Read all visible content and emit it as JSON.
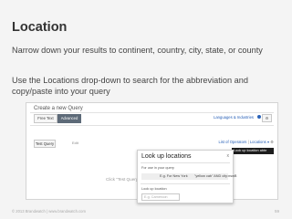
{
  "slide": {
    "title": "Location",
    "subtitle": "Narrow down your results to continent, country, city, state, or county",
    "note": "Use the Locations drop-down to search for the abbreviation and copy/paste into your query"
  },
  "app": {
    "heading": "Create a new Query",
    "tabs": [
      "Free Text",
      "Advanced"
    ],
    "active_tab": "Advanced",
    "languages_link": "Languages & Industries",
    "test_query_button": "Test Query",
    "edit_label": "Edit",
    "operators_link": "List of Operators",
    "locations_dropdown": "Locations",
    "tooltip": "Look up location abbr",
    "click_hint": "Click \"Test Query\"",
    "popup": {
      "title": "Look up locations",
      "close": "x",
      "use_label": "For use in your query",
      "example_prefix": "E.g. For New York",
      "example_query": "\"yellow cab\" AND city:nswB",
      "lookup_label": "Look up location",
      "lookup_placeholder": "E.g. Cameroon"
    }
  },
  "footer": {
    "text": "© 2013 Brandwatch  |  www.brandwatch.com",
    "page": "59"
  }
}
